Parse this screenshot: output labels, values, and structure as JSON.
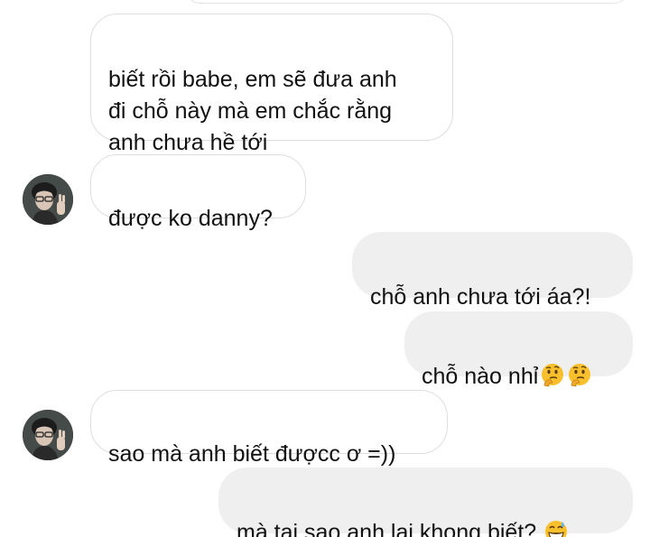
{
  "messages": [
    {
      "sender": "contact",
      "text": "biết rồi babe, em sẽ đưa anh\nđi chỗ này mà em chắc rằng\nanh chưa hề tới"
    },
    {
      "sender": "contact",
      "text": "được ko danny?"
    },
    {
      "sender": "me",
      "text": "chỗ anh chưa tới áa?!"
    },
    {
      "sender": "me",
      "text": "chỗ nào nhỉ",
      "emojis": [
        "thinking-face",
        "thinking-face"
      ]
    },
    {
      "sender": "contact",
      "text": "sao mà anh biết đượcc ơ =))"
    },
    {
      "sender": "me",
      "text": "mà tại sao anh lại khong biết?",
      "emojis": [
        "grinning-face-with-sweat"
      ]
    }
  ],
  "colors": {
    "incoming_bg": "#ffffff",
    "incoming_border": "#dedede",
    "outgoing_bg": "#efefef",
    "text": "#111111"
  }
}
